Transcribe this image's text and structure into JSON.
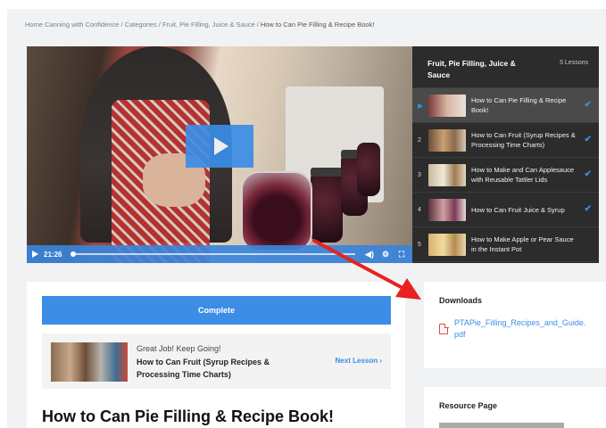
{
  "breadcrumb": {
    "items": [
      "Home Canning with Confidence",
      "Categories",
      "Fruit, Pie Filling, Juice & Sauce",
      "How to Can Pie Filling & Recipe Book!"
    ],
    "separator": "/"
  },
  "video": {
    "time": "21:26",
    "progress": 0.0,
    "icons": [
      "play-icon",
      "volume-icon",
      "settings-gear-icon",
      "fullscreen-icon"
    ]
  },
  "playlist": {
    "title": "Fruit, Pie Filling, Juice & Sauce",
    "count": "5 Lessons",
    "items": [
      {
        "num": "▶",
        "label": "How to Can Pie Filling & Recipe Book!",
        "done": "✔"
      },
      {
        "num": "2",
        "label": "How to Can Fruit (Syrup Recipes & Processing Time Charts)",
        "done": "✔"
      },
      {
        "num": "3",
        "label": "How to Make and Can Applesauce with Reusable Tattler Lids",
        "done": "✔"
      },
      {
        "num": "4",
        "label": "How to Can Fruit Juice & Syrup",
        "done": "✔"
      },
      {
        "num": "5",
        "label": "How to Make Apple or Pear Sauce in the Instant Pot",
        "done": ""
      }
    ]
  },
  "main": {
    "complete_label": "Complete",
    "next": {
      "kicker": "Great Job! Keep Going!",
      "title": "How to Can Fruit (Syrup Recipes & Processing Time Charts)",
      "link": "Next Lesson  ›"
    },
    "heading": "How to Can Pie Filling & Recipe Book!"
  },
  "downloads": {
    "heading": "Downloads",
    "file": "PTAPie_Filling_Recipes_and_Guide.pdf"
  },
  "resource": {
    "heading": "Resource Page"
  },
  "colors": {
    "accent": "#3b8de6",
    "playlist_bg": "#2c2c2c",
    "annotation_arrow": "#e8221f"
  }
}
